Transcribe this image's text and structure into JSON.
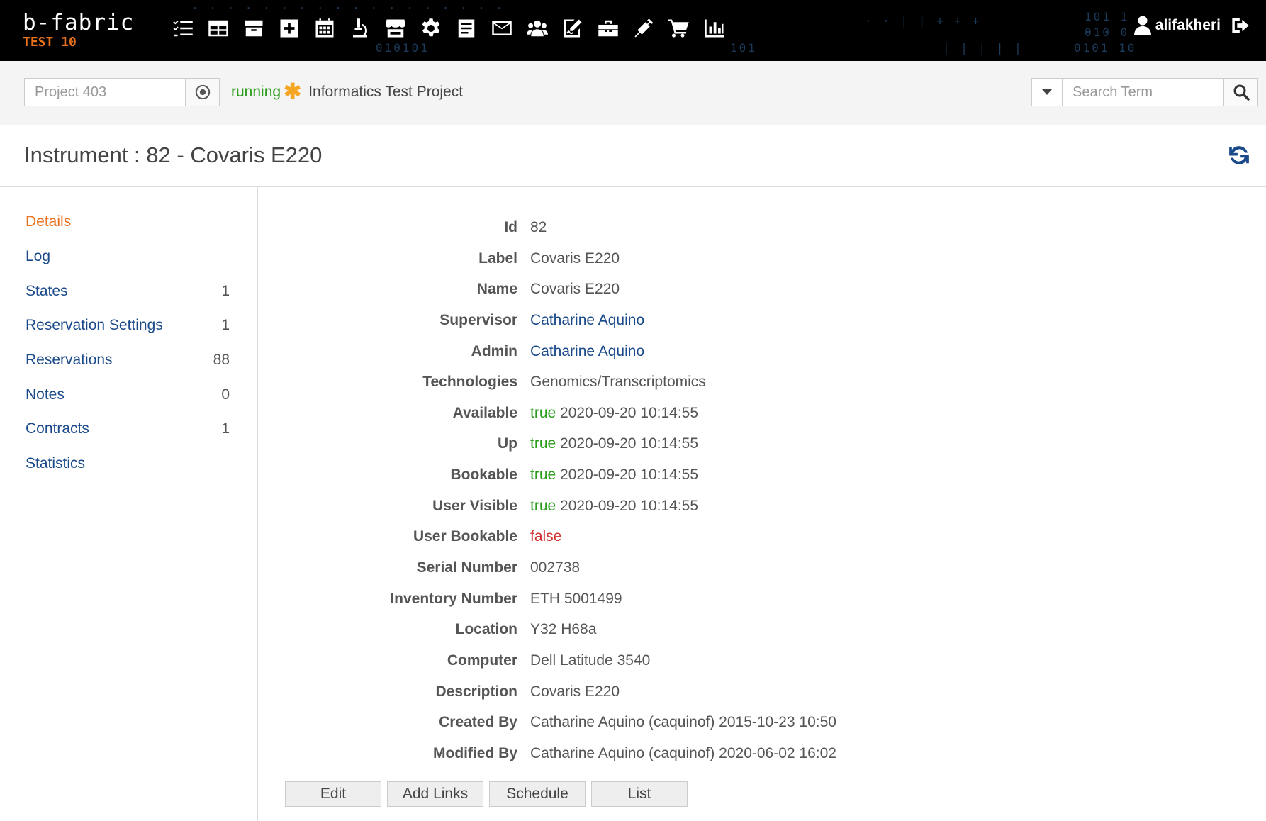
{
  "app": {
    "logo": "b-fabric",
    "env": "TEST 10",
    "user": "alifakheri"
  },
  "nav_icons": [
    "tasks-icon",
    "table-icon",
    "box-open-icon",
    "plus-square-icon",
    "calendar-icon",
    "microscope-icon",
    "store-icon",
    "gear-icon",
    "file-text-icon",
    "envelope-icon",
    "users-icon",
    "signature-icon",
    "toolbox-icon",
    "syringe-icon",
    "cart-icon",
    "chart-bar-icon"
  ],
  "project": {
    "placeholder": "Project 403",
    "status": "running",
    "name": "Informatics Test Project"
  },
  "search": {
    "placeholder": "Search Term"
  },
  "page": {
    "title": "Instrument : 82 - Covaris E220"
  },
  "sidebar": {
    "items": [
      {
        "label": "Details",
        "count": ""
      },
      {
        "label": "Log",
        "count": ""
      },
      {
        "label": "States",
        "count": "1"
      },
      {
        "label": "Reservation Settings",
        "count": "1"
      },
      {
        "label": "Reservations",
        "count": "88"
      },
      {
        "label": "Notes",
        "count": "0"
      },
      {
        "label": "Contracts",
        "count": "1"
      },
      {
        "label": "Statistics",
        "count": ""
      }
    ]
  },
  "details": {
    "id": {
      "label": "Id",
      "value": "82"
    },
    "label": {
      "label": "Label",
      "value": "Covaris E220"
    },
    "name": {
      "label": "Name",
      "value": "Covaris E220"
    },
    "supervisor": {
      "label": "Supervisor",
      "value": "Catharine Aquino"
    },
    "admin": {
      "label": "Admin",
      "value": "Catharine Aquino"
    },
    "technologies": {
      "label": "Technologies",
      "value": "Genomics/Transcriptomics"
    },
    "available": {
      "label": "Available",
      "flag": "true",
      "date": "2020-09-20 10:14:55"
    },
    "up": {
      "label": "Up",
      "flag": "true",
      "date": "2020-09-20 10:14:55"
    },
    "bookable": {
      "label": "Bookable",
      "flag": "true",
      "date": "2020-09-20 10:14:55"
    },
    "user_visible": {
      "label": "User Visible",
      "flag": "true",
      "date": "2020-09-20 10:14:55"
    },
    "user_bookable": {
      "label": "User Bookable",
      "flag": "false"
    },
    "serial": {
      "label": "Serial Number",
      "value": "002738"
    },
    "inventory": {
      "label": "Inventory Number",
      "value": "ETH 5001499"
    },
    "location": {
      "label": "Location",
      "value": "Y32 H68a"
    },
    "computer": {
      "label": "Computer",
      "value": "Dell Latitude 3540"
    },
    "description": {
      "label": "Description",
      "value": "Covaris E220"
    },
    "created_by": {
      "label": "Created By",
      "value": "Catharine Aquino (caquinof) 2015-10-23 10:50"
    },
    "modified_by": {
      "label": "Modified By",
      "value": "Catharine Aquino (caquinof) 2020-06-02 16:02"
    }
  },
  "buttons": {
    "edit": "Edit",
    "add_links": "Add Links",
    "schedule": "Schedule",
    "list": "List"
  },
  "colors": {
    "topbar": "#000000",
    "accent": "#e9711c",
    "link": "#1a4a8a",
    "true": "#2a9d1a",
    "false": "#d32f2f"
  }
}
